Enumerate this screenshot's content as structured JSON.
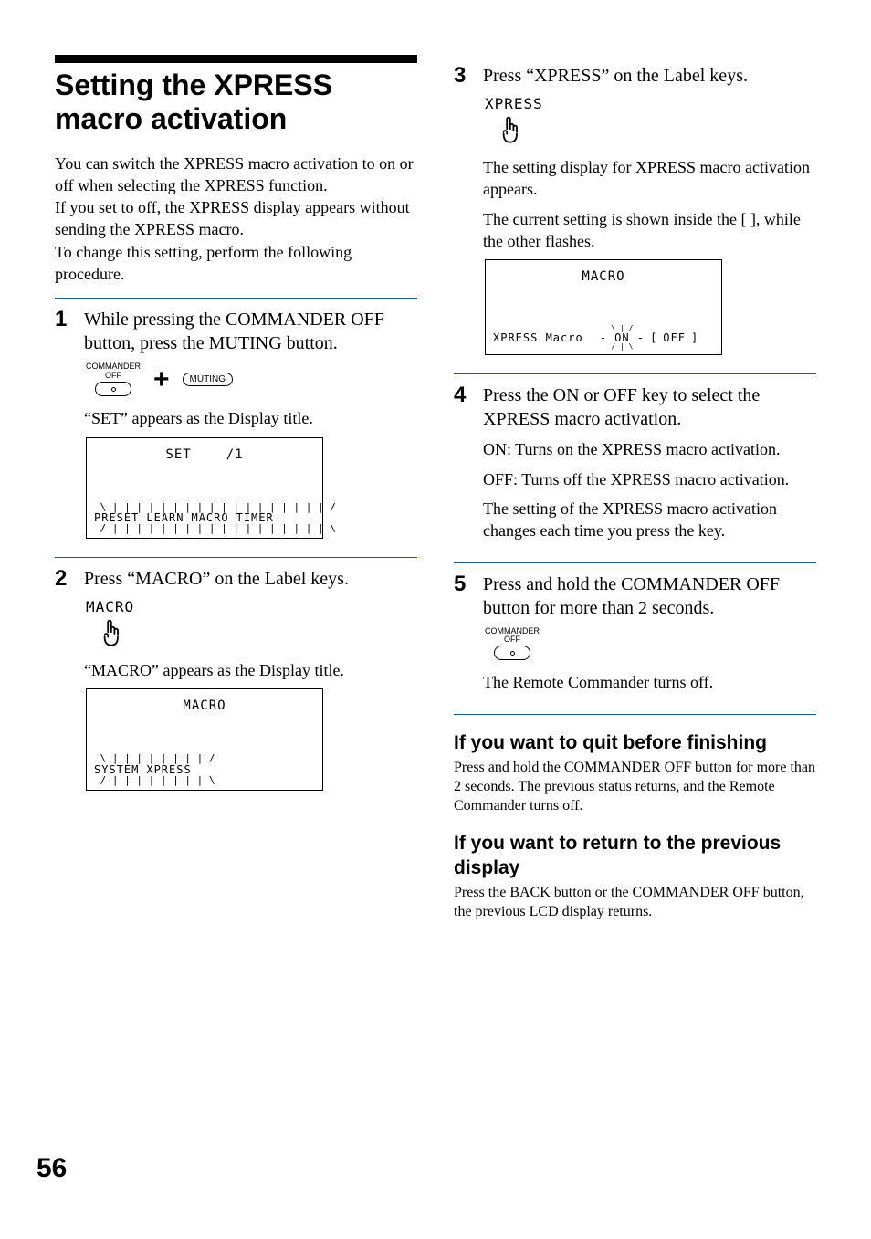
{
  "page_number": "56",
  "left": {
    "title": "Setting the XPRESS macro activation",
    "intro": "You can switch the XPRESS macro activation to on or off when selecting the XPRESS function.\nIf you set to off, the XPRESS display appears without sending the XPRESS macro.\nTo change this setting, perform the following procedure.",
    "step1": {
      "num": "1",
      "main": "While pressing the COMMANDER OFF button, press the MUTING button.",
      "btn_commander_top": "COMMANDER",
      "btn_commander_off": "OFF",
      "btn_muting": "MUTING",
      "plus": "+",
      "sub": "“SET” appears as the Display title.",
      "lcd": {
        "title_left": "SET",
        "title_right": "/1",
        "softkeys": [
          "PRESET",
          "LEARN",
          "MACRO",
          "TIMER"
        ]
      }
    },
    "step2": {
      "num": "2",
      "main": "Press “MACRO” on the Label keys.",
      "labelkey": "MACRO",
      "sub": "“MACRO” appears as the Display title.",
      "lcd": {
        "title": "MACRO",
        "softkeys": [
          "SYSTEM",
          "XPRESS"
        ]
      }
    }
  },
  "right": {
    "step3": {
      "num": "3",
      "main": "Press “XPRESS” on the Label keys.",
      "labelkey": "XPRESS",
      "sub1": "The setting display for XPRESS macro activation appears.",
      "sub2": "The current setting is shown inside the [ ], while the other flashes.",
      "lcd": {
        "title": "MACRO",
        "row_label": "XPRESS Macro",
        "on": "ON",
        "off": "OFF",
        "bracket_open": "[",
        "bracket_close": "]"
      }
    },
    "step4": {
      "num": "4",
      "main": "Press the ON or OFF key to select the XPRESS macro activation.",
      "sub1": "ON: Turns on the XPRESS macro activation.",
      "sub2": "OFF: Turns off the XPRESS macro activation.",
      "sub3": "The setting of the XPRESS macro activation changes each time you press the key."
    },
    "step5": {
      "num": "5",
      "main": "Press and hold the COMMANDER OFF button for more than 2 seconds.",
      "btn_commander_top": "COMMANDER",
      "btn_commander_off": "OFF",
      "sub": "The Remote Commander turns off."
    },
    "quit": {
      "head": "If you want to quit before finishing",
      "body": "Press and hold the COMMANDER OFF button for more than 2 seconds. The previous status returns, and the Remote Commander turns off."
    },
    "return": {
      "head": "If you want to return to the previous display",
      "body": "Press the BACK button or the COMMANDER OFF button, the previous LCD display returns."
    }
  }
}
